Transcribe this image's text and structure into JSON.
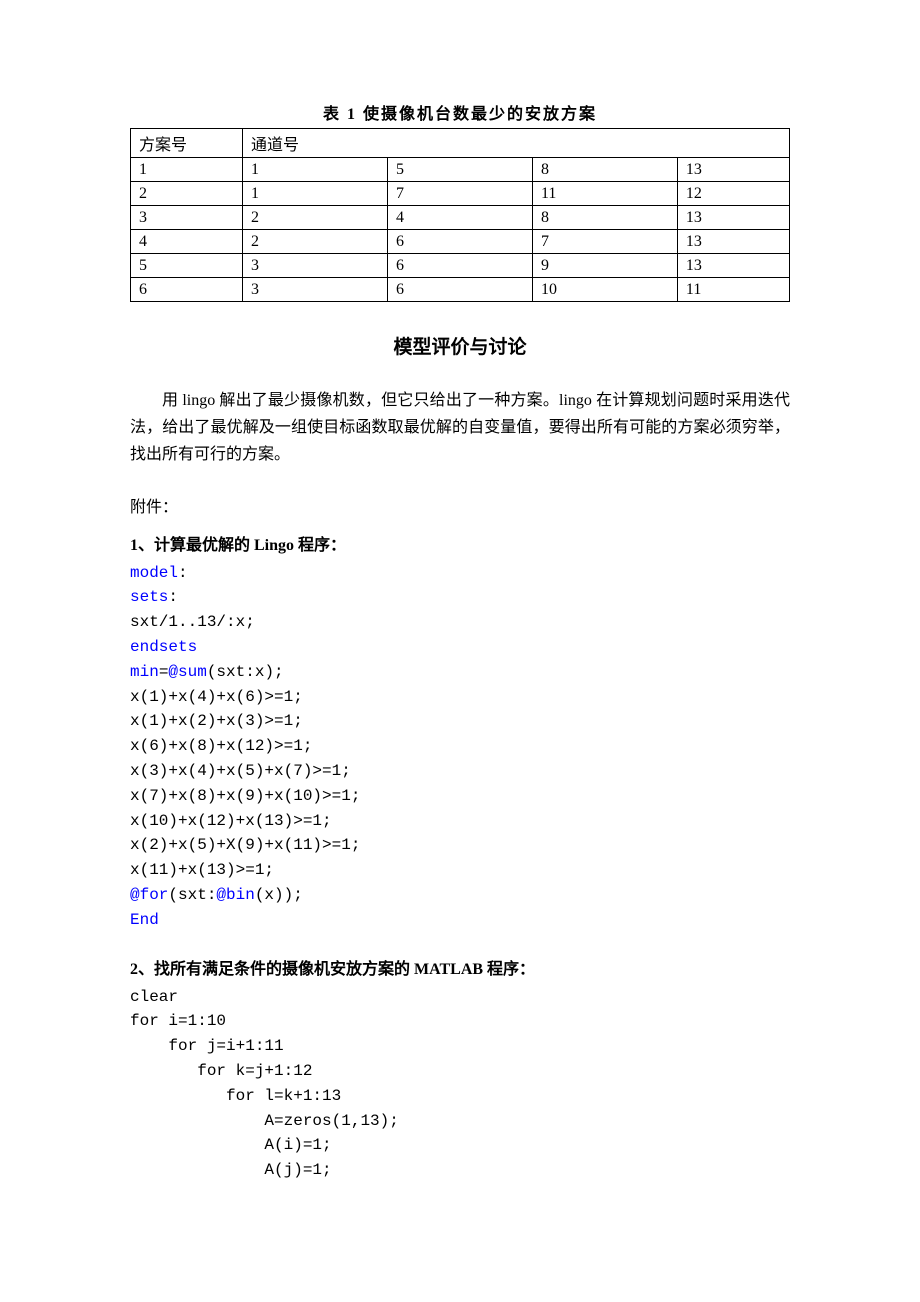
{
  "table": {
    "title": "表 1   使摄像机台数最少的安放方案",
    "header": {
      "col1": "方案号",
      "col2": "通道号"
    },
    "rows": [
      {
        "c1": "1",
        "c2": "1",
        "c3": "5",
        "c4": "8",
        "c5": "13"
      },
      {
        "c1": "2",
        "c2": "1",
        "c3": "7",
        "c4": "11",
        "c5": "12"
      },
      {
        "c1": "3",
        "c2": "2",
        "c3": "4",
        "c4": "8",
        "c5": "13"
      },
      {
        "c1": "4",
        "c2": "2",
        "c3": "6",
        "c4": "7",
        "c5": "13"
      },
      {
        "c1": "5",
        "c2": "3",
        "c3": "6",
        "c4": "9",
        "c5": "13"
      },
      {
        "c1": "6",
        "c2": "3",
        "c3": "6",
        "c4": "10",
        "c5": "11"
      }
    ]
  },
  "section_head": "模型评价与讨论",
  "paragraph": "用 lingo 解出了最少摄像机数，但它只给出了一种方案。lingo 在计算规划问题时采用迭代法，给出了最优解及一组使目标函数取最优解的自变量值，要得出所有可能的方案必须穷举，找出所有可行的方案。",
  "attach_label": "附件：",
  "lingo": {
    "title": "1、计算最优解的 Lingo 程序：",
    "kw_model": "model",
    "colon1": ":",
    "kw_sets": "sets",
    "colon2": ":",
    "line_sxt": "sxt/1..13/:x;",
    "kw_endsets": "endsets",
    "kw_min": "min",
    "eq": "=",
    "kw_sum": "@sum",
    "sum_tail": "(sxt:x);",
    "c1": "x(1)+x(4)+x(6)>=1;",
    "c2": "x(1)+x(2)+x(3)>=1;",
    "c3": "x(6)+x(8)+x(12)>=1;",
    "c4": "x(3)+x(4)+x(5)+x(7)>=1;",
    "c5": "x(7)+x(8)+x(9)+x(10)>=1;",
    "c6": "x(10)+x(12)+x(13)>=1;",
    "c7": "x(2)+x(5)+X(9)+x(11)>=1;",
    "c8": "x(11)+x(13)>=1;",
    "kw_for": "@for",
    "for_mid": "(sxt:",
    "kw_bin": "@bin",
    "for_tail": "(x));",
    "kw_end": "End"
  },
  "matlab": {
    "title": "2、找所有满足条件的摄像机安放方案的 MATLAB 程序：",
    "l1": "clear",
    "l2": "for i=1:10",
    "l3": "    for j=i+1:11",
    "l4": "       for k=j+1:12",
    "l5": "          for l=k+1:13",
    "l6": "              A=zeros(1,13);",
    "l7": "              A(i)=1;",
    "l8": "              A(j)=1;"
  }
}
